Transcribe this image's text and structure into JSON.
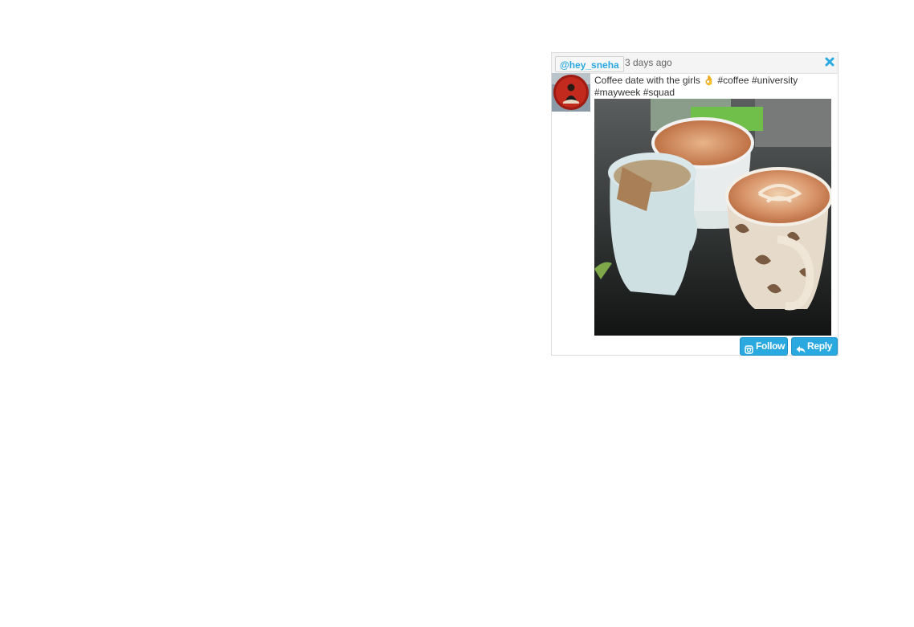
{
  "post": {
    "handle": "@hey_sneha",
    "time": "3 days ago",
    "caption": "Coffee date with the girls 👌 #coffee #university #mayweek #squad"
  },
  "actions": {
    "follow_label": "Follow",
    "reply_label": "Reply"
  },
  "icons": {
    "close": "close-icon",
    "follow": "instagram-icon",
    "reply": "reply-icon"
  },
  "colors": {
    "accent": "#2aa9e0",
    "header_bg": "#f4f4f4"
  }
}
